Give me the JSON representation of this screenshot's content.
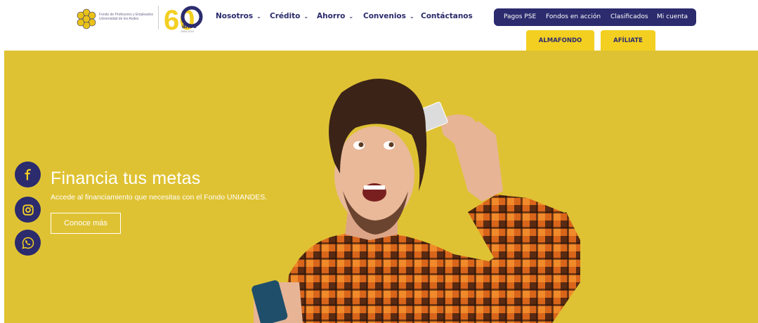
{
  "brand": {
    "logo_text": "Fondo de Profesores y Empleados Universidad de los Andes",
    "anniversary_number": "60",
    "anniversary_word": "años",
    "anniversary_years": "1964-2024",
    "colors": {
      "navy": "#2b2b6e",
      "yellow": "#f3cf21",
      "hero_bg": "#dfc233"
    }
  },
  "nav": {
    "items": [
      {
        "label": "Nosotros",
        "icon": "chevron-down-icon"
      },
      {
        "label": "Crédito",
        "icon": "chevron-down-icon"
      },
      {
        "label": "Ahorro",
        "icon": "chevron-down-icon"
      },
      {
        "label": "Convenios",
        "icon": "chevron-down-icon"
      },
      {
        "label": "Contáctanos"
      }
    ]
  },
  "topbar": {
    "links": [
      "Pagos PSE",
      "Fondos en acción",
      "Clasificados",
      "Mi cuenta"
    ]
  },
  "buttons": {
    "almafondo": "ALMAFONDO",
    "afiliate": "AFÍLIATE"
  },
  "hero": {
    "title": "Financia tus metas",
    "subtitle": "Accede al financiamiento que necesitas con el Fondo UNIANDES.",
    "cta": "Conoce más"
  },
  "social": [
    "facebook-icon",
    "instagram-icon",
    "whatsapp-icon"
  ]
}
